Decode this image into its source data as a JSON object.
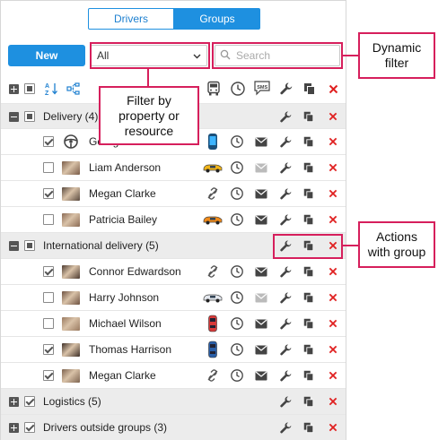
{
  "tabs": [
    {
      "label": "Drivers",
      "active": false
    },
    {
      "label": "Groups",
      "active": true
    }
  ],
  "toolbar": {
    "new_label": "New",
    "filter_value": "All",
    "search_placeholder": "Search"
  },
  "header_icons": [
    "expand-all-icon",
    "select-all-icon",
    "sort-az-icon",
    "hierarchy-icon",
    "vehicle-column-icon",
    "clock-column-icon",
    "sms-column-icon",
    "wrench-column-icon",
    "copy-column-icon",
    "delete-column-icon"
  ],
  "groups": [
    {
      "name": "Delivery (4)",
      "expanded": true,
      "checkbox": "partial"
    },
    {
      "name": "International delivery (5)",
      "expanded": true,
      "checkbox": "partial"
    },
    {
      "name": "Logistics (5)",
      "expanded": false,
      "checkbox": "checked"
    },
    {
      "name": "Drivers outside groups (3)",
      "expanded": false,
      "checkbox": "checked"
    }
  ],
  "drivers": [
    {
      "name": "George",
      "checked": true,
      "unit": "phone",
      "avatar": "steering-wheel-icon",
      "message_active": true
    },
    {
      "name": "Liam Anderson",
      "checked": false,
      "unit": "yellow-car",
      "avatar": "photo",
      "message_active": false
    },
    {
      "name": "Megan Clarke",
      "checked": true,
      "unit": "unlinked",
      "avatar": "photo",
      "message_active": true
    },
    {
      "name": "Patricia Bailey",
      "checked": false,
      "unit": "orange-car",
      "avatar": "photo",
      "message_active": true
    },
    {
      "name": "Connor Edwardson",
      "checked": true,
      "unit": "unlinked",
      "avatar": "photo",
      "message_active": true
    },
    {
      "name": "Harry Johnson",
      "checked": false,
      "unit": "white-car",
      "avatar": "photo",
      "message_active": false
    },
    {
      "name": "Michael Wilson",
      "checked": false,
      "unit": "red-car",
      "avatar": "photo",
      "message_active": true
    },
    {
      "name": "Thomas Harrison",
      "checked": true,
      "unit": "blue-car",
      "avatar": "photo",
      "message_active": true
    },
    {
      "name": "Megan Clarke",
      "checked": true,
      "unit": "unlinked",
      "avatar": "photo",
      "message_active": true
    }
  ],
  "callouts": {
    "dynamic_filter": "Dynamic\nfilter",
    "filter_by": "Filter by\nproperty or\nresource",
    "actions_group": "Actions\nwith group"
  },
  "colors": {
    "accent": "#1e90e0",
    "highlight": "#d61f5c",
    "delete": "#e02020"
  }
}
